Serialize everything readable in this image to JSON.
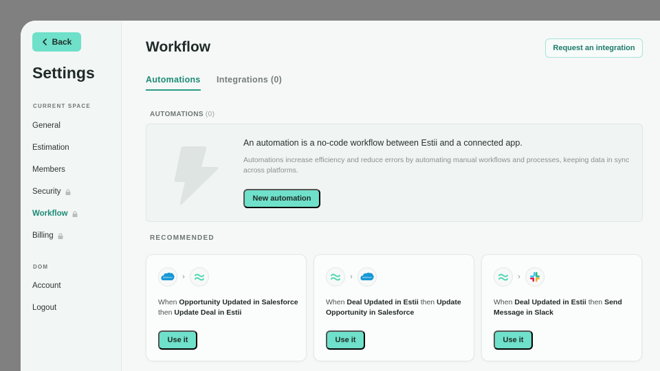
{
  "sidebar": {
    "back_label": "Back",
    "title": "Settings",
    "sections": [
      {
        "label": "CURRENT SPACE",
        "items": [
          {
            "label": "General",
            "locked": false,
            "active": false
          },
          {
            "label": "Estimation",
            "locked": false,
            "active": false
          },
          {
            "label": "Members",
            "locked": false,
            "active": false
          },
          {
            "label": "Security",
            "locked": true,
            "active": false
          },
          {
            "label": "Workflow",
            "locked": true,
            "active": true
          },
          {
            "label": "Billing",
            "locked": true,
            "active": false
          }
        ]
      },
      {
        "label": "DOM",
        "items": [
          {
            "label": "Account",
            "locked": false,
            "active": false
          },
          {
            "label": "Logout",
            "locked": false,
            "active": false
          }
        ]
      }
    ]
  },
  "header": {
    "title": "Workflow",
    "request_button": "Request an integration"
  },
  "tabs": [
    {
      "label": "Automations",
      "active": true
    },
    {
      "label": "Integrations (0)",
      "active": false
    }
  ],
  "automations": {
    "label": "AUTOMATIONS",
    "count": "(0)",
    "empty_heading": "An automation is a no-code workflow between Estii and a connected app.",
    "empty_description": "Automations increase efficiency and reduce errors by automating manual workflows and processes, keeping data in sync across platforms.",
    "new_button": "New automation",
    "empty_icon": "lightning-bolt-icon"
  },
  "recommended": {
    "label": "RECOMMENDED",
    "cards": [
      {
        "from_icon": "salesforce-icon",
        "to_icon": "estii-icon",
        "parts": [
          {
            "text": "When ",
            "bold": false
          },
          {
            "text": "Opportunity Updated in Salesforce",
            "bold": true
          },
          {
            "text": " then ",
            "bold": false
          },
          {
            "text": "Update Deal in Estii",
            "bold": true
          }
        ],
        "button": "Use it"
      },
      {
        "from_icon": "estii-icon",
        "to_icon": "salesforce-icon",
        "parts": [
          {
            "text": "When ",
            "bold": false
          },
          {
            "text": "Deal Updated in Estii",
            "bold": true
          },
          {
            "text": " then ",
            "bold": false
          },
          {
            "text": "Update Opportunity in Salesforce",
            "bold": true
          }
        ],
        "button": "Use it"
      },
      {
        "from_icon": "estii-icon",
        "to_icon": "slack-icon",
        "parts": [
          {
            "text": "When ",
            "bold": false
          },
          {
            "text": "Deal Updated in Estii",
            "bold": true
          },
          {
            "text": " then ",
            "bold": false
          },
          {
            "text": "Send Message in Slack",
            "bold": true
          }
        ],
        "button": "Use it"
      }
    ]
  },
  "colors": {
    "accent": "#6fe0c9",
    "accent_text": "#1d8a76",
    "background": "#f5f8f7"
  }
}
